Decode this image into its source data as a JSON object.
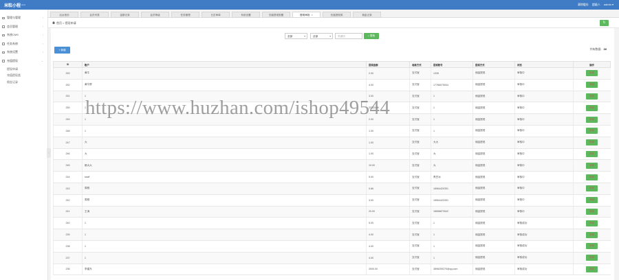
{
  "app": {
    "title": "米粒小程",
    "version": "v1.3"
  },
  "topbar": {
    "links": [
      "清除缓存",
      "超级人"
    ],
    "user": "admin ▾"
  },
  "sidebar": {
    "items": [
      {
        "label": "管理与管理"
      },
      {
        "label": "会员管理"
      },
      {
        "label": "系统CMS"
      },
      {
        "label": "任务系统"
      },
      {
        "label": "系统设置"
      },
      {
        "label": "充值提现"
      }
    ],
    "subitems": [
      "提现申请",
      "充值提现类",
      "佣金记录"
    ]
  },
  "tabs": [
    "后台首页",
    "会员列表",
    "金额记录",
    "会员等级",
    "任务管理",
    "日志审单",
    "系统设置",
    "充值提现配置",
    "提现审批",
    "充值提现类",
    "佣金记录"
  ],
  "breadcrumb": {
    "home": "首页",
    "sep": ">",
    "current": "提现申请"
  },
  "filters": {
    "select1": "全部",
    "select2": "全部",
    "keyword_placeholder": "关键词",
    "search_label": "搜索"
  },
  "toolbar": {
    "add_label": "+ 新增",
    "total_label": "共有数据:",
    "total_count": "30"
  },
  "table": {
    "columns": [
      "ID",
      "账户",
      "提现金额",
      "收款方式",
      "提现账号",
      "提现方式",
      "状态",
      "操作"
    ],
    "rows": [
      {
        "id": "253",
        "account": "黄牛",
        "amount": "2.00",
        "method": "支付宝",
        "number": "1335",
        "type": "佣金提现",
        "status": "审核中",
        "ok": false
      },
      {
        "id": "252",
        "account": "黄牛群",
        "amount": "4.00",
        "method": "支付宝",
        "number": "17786075534",
        "type": "佣金提现",
        "status": "审核中",
        "ok": false
      },
      {
        "id": "251",
        "account": "1",
        "amount": "3.00",
        "method": "支付宝",
        "number": "1",
        "type": "佣金提现",
        "status": "审核中",
        "ok": false
      },
      {
        "id": "250",
        "account": "1",
        "amount": "33333.00",
        "method": "支付宝",
        "number": "1",
        "type": "佣金提现",
        "status": "审核中",
        "ok": false
      },
      {
        "id": "249",
        "account": "1",
        "amount": "2.00",
        "method": "支付宝",
        "number": "1",
        "type": "佣金提现",
        "status": "审核中",
        "ok": false
      },
      {
        "id": "248",
        "account": "1",
        "amount": "1.00",
        "method": "支付宝",
        "number": "1",
        "type": "佣金提现",
        "status": "审核中",
        "ok": false
      },
      {
        "id": "247",
        "account": "大",
        "amount": "1.00",
        "method": "支付宝",
        "number": "大大",
        "type": "佣金提现",
        "status": "审核中",
        "ok": false
      },
      {
        "id": "246",
        "account": "大",
        "amount": "1.00",
        "method": "支付宝",
        "number": "大",
        "type": "佣金提现",
        "status": "审核中",
        "ok": false
      },
      {
        "id": "245",
        "account": "都大大",
        "amount": "10.00",
        "method": "支付宝",
        "number": "大",
        "type": "佣金提现",
        "status": "审核中",
        "ok": false
      },
      {
        "id": "244",
        "account": "sssff",
        "amount": "5.00",
        "method": "支付宝",
        "number": "青豆冰",
        "type": "佣金提现",
        "status": "审核中",
        "ok": false
      },
      {
        "id": "243",
        "account": "周刚",
        "amount": "0.66",
        "method": "支付宝",
        "number": "18964420351",
        "type": "佣金提现",
        "status": "审核中",
        "ok": false
      },
      {
        "id": "242",
        "account": "周刚",
        "amount": "3.00",
        "method": "支付宝",
        "number": "18964420351",
        "type": "佣金提现",
        "status": "审核中",
        "ok": false
      },
      {
        "id": "241",
        "account": "王涛",
        "amount": "20.00",
        "method": "支付宝",
        "number": "18658873542",
        "type": "佣金提现",
        "status": "审核中",
        "ok": false
      },
      {
        "id": "240",
        "account": "1",
        "amount": "5.00",
        "method": "支付宝",
        "number": "1",
        "type": "佣金提现",
        "status": "审核成功",
        "ok": true
      },
      {
        "id": "239",
        "account": "1",
        "amount": "4.00",
        "method": "支付宝",
        "number": "1",
        "type": "佣金提现",
        "status": "审核成功",
        "ok": true
      },
      {
        "id": "238",
        "account": "1",
        "amount": "4.00",
        "method": "支付宝",
        "number": "1",
        "type": "佣金提现",
        "status": "审核成功",
        "ok": true
      },
      {
        "id": "237",
        "account": "1",
        "amount": "4.00",
        "method": "支付宝",
        "number": "1",
        "type": "佣金提现",
        "status": "审核成功",
        "ok": true
      },
      {
        "id": "236",
        "account": "李建东",
        "amount": "3000.00",
        "method": "支付宝",
        "number": "3898259275@qq.com",
        "type": "佣金提现",
        "status": "审核成功",
        "ok": true
      }
    ],
    "action_label": "审核"
  },
  "watermark": "https://www.huzhan.com/ishop49544"
}
